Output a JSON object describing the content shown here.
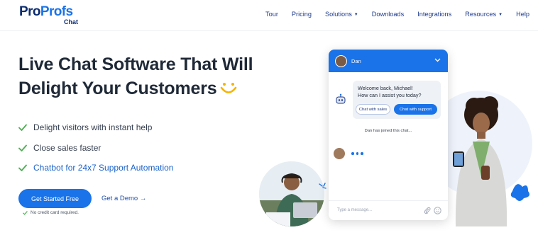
{
  "brand": {
    "name_part1": "Pro",
    "name_part2": "Profs",
    "sub": "Chat"
  },
  "nav": {
    "items": [
      {
        "label": "Tour"
      },
      {
        "label": "Pricing"
      },
      {
        "label": "Solutions",
        "has_caret": true
      },
      {
        "label": "Downloads"
      },
      {
        "label": "Integrations"
      },
      {
        "label": "Resources",
        "has_caret": true
      },
      {
        "label": "Help"
      }
    ]
  },
  "hero": {
    "headline_line1": "Live Chat Software That Will",
    "headline_line2": "Delight Your Customers",
    "bullets": [
      {
        "text": "Delight visitors with instant help"
      },
      {
        "text": "Close sales faster"
      },
      {
        "text": "Chatbot for 24x7 Support Automation"
      }
    ],
    "cta_label": "Get Started Free",
    "demo_label": "Get a Demo →",
    "no_cc": "No credit card required."
  },
  "chat_widget": {
    "agent_name": "Dan",
    "greeting_line1": "Welcome back, Michael!",
    "greeting_line2": "How can I assist you today?",
    "quick_reply_1": "Chat with sales",
    "quick_reply_2": "Chat with support",
    "join_notice": "Dan has joined this chat...",
    "input_placeholder": "Type a message..."
  },
  "colors": {
    "accent": "#1a73e8",
    "check_green": "#4caf50",
    "heading": "#1f2937"
  }
}
